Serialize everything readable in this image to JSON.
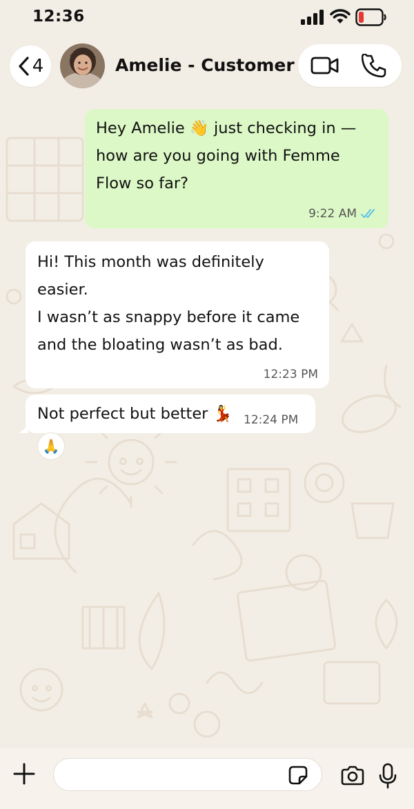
{
  "status_bar": {
    "time": "12:36"
  },
  "header": {
    "back_count": "4",
    "contact_name": "Amelie - Customer"
  },
  "messages": [
    {
      "direction": "outgoing",
      "lines": [
        "Hey Amelie 👋 just checking in —",
        "how are you going with Femme",
        "Flow so far?"
      ],
      "time": "9:22 AM"
    },
    {
      "direction": "incoming",
      "lines": [
        "Hi! This month was definitely",
        "easier.",
        "I wasn’t as snappy before it came",
        "and the bloating wasn’t as bad."
      ],
      "time": "12:23 PM"
    },
    {
      "direction": "incoming",
      "text": "Not perfect but better 💃",
      "time": "12:24 PM",
      "reaction": "🙏"
    }
  ],
  "composer": {
    "placeholder": ""
  },
  "icons": {
    "back": "chevron-left-icon",
    "video": "video-camera-icon",
    "phone": "phone-icon",
    "plus": "plus-icon",
    "sticker": "sticker-icon",
    "camera": "camera-icon",
    "mic": "microphone-icon"
  },
  "colors": {
    "outgoing_bubble": "#dcf8c6",
    "incoming_bubble": "#ffffff",
    "read_ticks": "#53bdeb",
    "wallpaper": "#f3eee5",
    "battery_low": "#e53935"
  }
}
